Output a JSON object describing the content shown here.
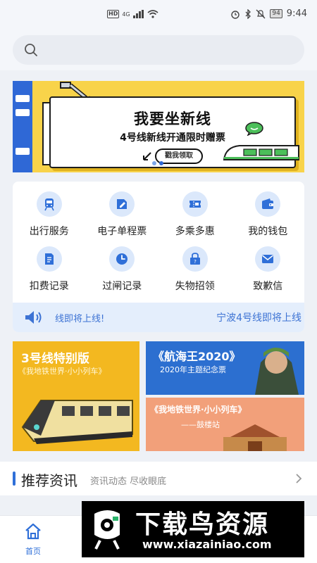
{
  "status_bar": {
    "network_badge": "HD",
    "signal_text": "4G",
    "battery": "94",
    "time": "9:44"
  },
  "search": {
    "placeholder": ""
  },
  "banner": {
    "title": "我要坐新线",
    "subtitle": "4号线新线开通限时赠票",
    "button": "戳我领取",
    "slide_count": 2,
    "active_slide": 1
  },
  "services": {
    "items": [
      {
        "label": "出行服务",
        "icon": "train-icon"
      },
      {
        "label": "电子单程票",
        "icon": "ticket-edit-icon"
      },
      {
        "label": "多乘多惠",
        "icon": "coupon-icon"
      },
      {
        "label": "我的钱包",
        "icon": "wallet-icon"
      },
      {
        "label": "扣费记录",
        "icon": "document-icon"
      },
      {
        "label": "过闸记录",
        "icon": "clock-icon"
      },
      {
        "label": "失物招领",
        "icon": "lost-found-icon"
      },
      {
        "label": "致歉信",
        "icon": "mail-icon"
      }
    ],
    "accent": "#2f6fd8",
    "icon_bg": "#dbe8fb"
  },
  "notice": {
    "text_left": "线即将上线!",
    "text_right": "宁波4号线即将上线"
  },
  "promos": {
    "a": {
      "title": "3号线特别版",
      "sub": "《我地铁世界·小小列车》"
    },
    "b": {
      "title": "《航海王2020》",
      "sub": "2020年主题纪念票"
    },
    "c": {
      "title": "《我地铁世界·小小列车》",
      "sub": "——鼓楼站"
    }
  },
  "recommend": {
    "title": "推荐资讯",
    "subtitle": "资讯动态 尽收眼底"
  },
  "bottom_nav": {
    "home_label": "首页"
  },
  "watermark": {
    "title": "下载鸟资源",
    "url": "www.xiazainiao.com"
  }
}
